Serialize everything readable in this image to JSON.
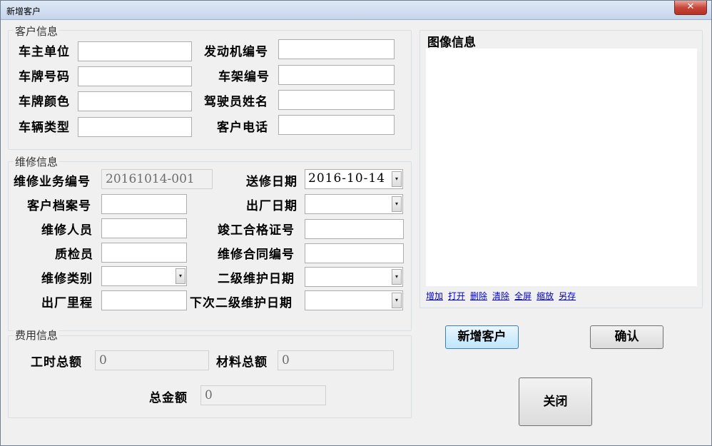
{
  "window": {
    "title": "新增客户",
    "close_label": "✕"
  },
  "customer_info": {
    "group_title": "客户信息",
    "owner_unit": {
      "label": "车主单位",
      "value": ""
    },
    "plate_number": {
      "label": "车牌号码",
      "value": ""
    },
    "plate_color": {
      "label": "车牌颜色",
      "value": ""
    },
    "vehicle_type": {
      "label": "车辆类型",
      "value": ""
    },
    "engine_number": {
      "label": "发动机编号",
      "value": ""
    },
    "frame_number": {
      "label": "车架编号",
      "value": ""
    },
    "driver_name": {
      "label": "驾驶员姓名",
      "value": ""
    },
    "customer_phone": {
      "label": "客户电话",
      "value": ""
    }
  },
  "repair_info": {
    "group_title": "维修信息",
    "business_no": {
      "label": "维修业务编号",
      "value": "20161014-001"
    },
    "archive_no": {
      "label": "客户档案号",
      "value": ""
    },
    "repair_staff": {
      "label": "维修人员",
      "value": ""
    },
    "inspector": {
      "label": "质检员",
      "value": ""
    },
    "repair_category": {
      "label": "维修类别",
      "value": ""
    },
    "exit_mileage": {
      "label": "出厂里程",
      "value": ""
    },
    "send_date": {
      "label": "送修日期",
      "value": "2016-10-14"
    },
    "exit_date": {
      "label": "出厂日期",
      "value": ""
    },
    "completion_cert": {
      "label": "竣工合格证号",
      "value": ""
    },
    "contract_no": {
      "label": "维修合同编号",
      "value": ""
    },
    "level2_date": {
      "label": "二级维护日期",
      "value": ""
    },
    "next_level2_date": {
      "label": "下次二级维护日期",
      "value": ""
    }
  },
  "fee_info": {
    "group_title": "费用信息",
    "labor_total": {
      "label": "工时总额",
      "value": "0"
    },
    "material_total": {
      "label": "材料总额",
      "value": "0"
    },
    "grand_total": {
      "label": "总金额",
      "value": "0"
    }
  },
  "image_info": {
    "title": "图像信息",
    "links": [
      "增加",
      "打开",
      "删除",
      "清除",
      "全屏",
      "缩放",
      "另存"
    ]
  },
  "buttons": {
    "add_customer": "新增客户",
    "confirm": "确认",
    "close": "关闭"
  }
}
